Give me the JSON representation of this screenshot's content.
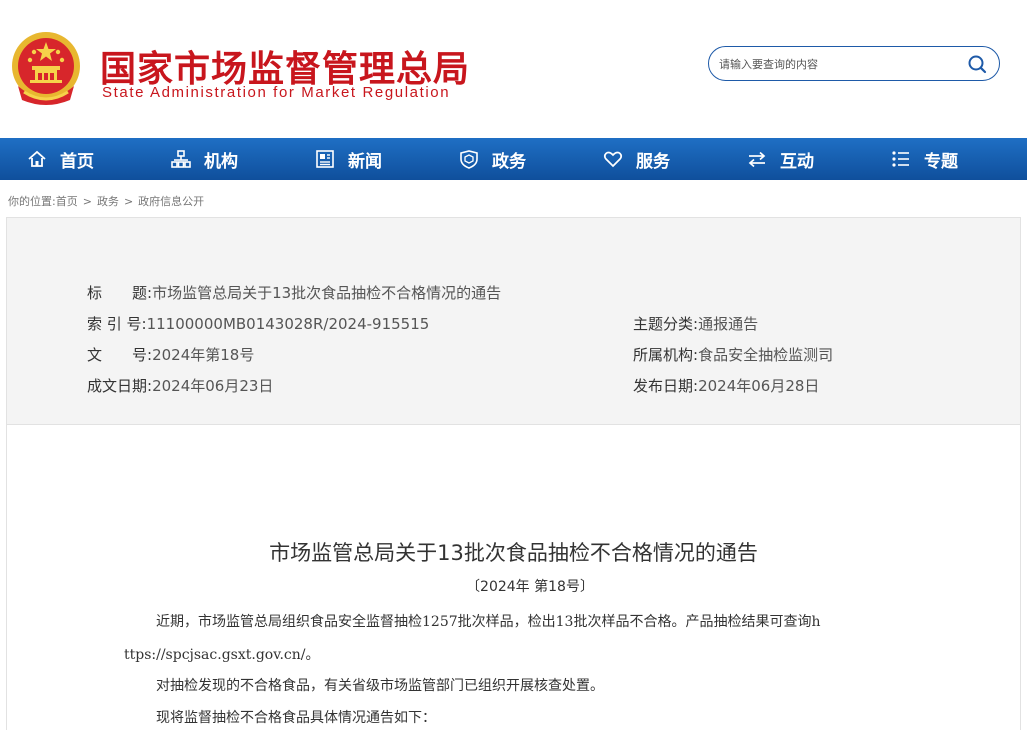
{
  "header": {
    "site_name_cn": "国家市场监督管理总局",
    "site_name_en": "State Administration for Market Regulation",
    "search_placeholder": "请输入要查询的内容"
  },
  "nav": {
    "items": [
      {
        "label": "首页",
        "icon": "home-icon"
      },
      {
        "label": "机构",
        "icon": "org-chart-icon"
      },
      {
        "label": "新闻",
        "icon": "newspaper-icon"
      },
      {
        "label": "政务",
        "icon": "shield-icon"
      },
      {
        "label": "服务",
        "icon": "heart-icon"
      },
      {
        "label": "互动",
        "icon": "swap-arrows-icon"
      },
      {
        "label": "专题",
        "icon": "list-icon"
      }
    ]
  },
  "breadcrumb": {
    "prefix": "你的位置:",
    "items": [
      "首页",
      "政务",
      "政府信息公开"
    ],
    "separator": ">"
  },
  "meta": {
    "title_label": "标　　题:",
    "title_value": "市场监管总局关于13批次食品抽检不合格情况的通告",
    "index_label": "索 引 号:",
    "index_value": "11100000MB0143028R/2024-915515",
    "docnum_label": "文　　号:",
    "docnum_value": "2024年第18号",
    "date_made_label": "成文日期:",
    "date_made_value": "2024年06月23日",
    "category_label": "主题分类:",
    "category_value": "通报通告",
    "org_label": "所属机构:",
    "org_value": "食品安全抽检监测司",
    "pub_date_label": "发布日期:",
    "pub_date_value": "2024年06月28日"
  },
  "article": {
    "title": "市场监管总局关于13批次食品抽检不合格情况的通告",
    "doc_number": "〔2024年 第18号〕",
    "para1_line1": "近期，市场监管总局组织食品安全监督抽检1257批次样品，检出13批次样品不合格。产品抽检结果可查询h",
    "para1_line2": "ttps://spcjsac.gsxt.gov.cn/。",
    "para2": "对抽检发现的不合格食品，有关省级市场监管部门已组织开展核查处置。",
    "para3": "现将监督抽检不合格食品具体情况通告如下："
  },
  "colors": {
    "brand_red": "#c8161d",
    "nav_blue": "#1a62b5",
    "meta_bg": "#f4f4f4"
  }
}
